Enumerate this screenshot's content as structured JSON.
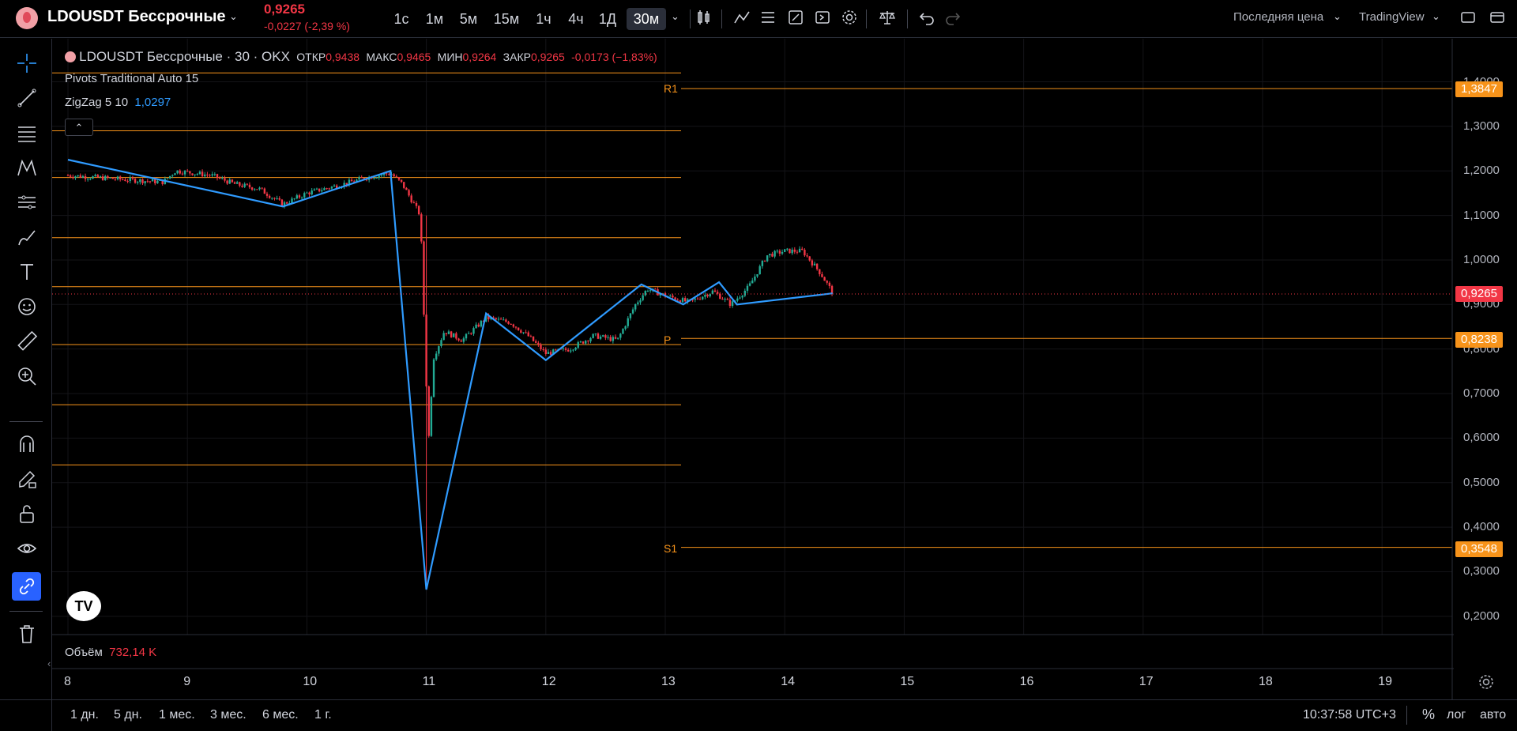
{
  "header": {
    "symbol": "LDOUSDT Бессрочные",
    "price": "0,9265",
    "change": "-0,0227 (-2,39 %)",
    "timeframes": [
      "1с",
      "1м",
      "5м",
      "15м",
      "1ч",
      "4ч",
      "1Д",
      "30м"
    ],
    "active_timeframe": "30м",
    "price_type": "Последняя цена",
    "brand": "TradingView"
  },
  "legend": {
    "title": "LDOUSDT Бессрочные · 30 · OKX",
    "open_label": "ОТКР",
    "open": "0,9438",
    "high_label": "МАКС",
    "high": "0,9465",
    "low_label": "МИН",
    "low": "0,9264",
    "close_label": "ЗАКР",
    "close": "0,9265",
    "delta": "-0,0173 (−1,83%)",
    "pivots": "Pivots Traditional Auto 15",
    "zigzag": "ZigZag 5 10",
    "zigzag_value": "1,0297",
    "volume_label": "Объём",
    "volume_value": "732,14 K"
  },
  "chart_data": {
    "type": "candlestick",
    "y_ticks": [
      "1,4000",
      "1,3000",
      "1,2000",
      "1,1000",
      "1,0000",
      "0,9000",
      "0,8000",
      "0,7000",
      "0,6000",
      "0,5000",
      "0,4000",
      "0,3000",
      "0,2000"
    ],
    "x_ticks": [
      "8",
      "9",
      "10",
      "11",
      "12",
      "13",
      "14",
      "15",
      "16",
      "17",
      "18",
      "19"
    ],
    "pivot_labels": {
      "r1": "R1",
      "p": "P",
      "s1": "S1"
    },
    "price_tags": {
      "r1": "1,3847",
      "last": "0,9265",
      "p": "0,8238",
      "s1": "0,3548"
    },
    "pivot_levels": [
      1.3847,
      0.8238,
      0.3548
    ],
    "zigzag_points": [
      [
        8.0,
        1.225
      ],
      [
        9.8,
        1.12
      ],
      [
        10.7,
        1.2
      ],
      [
        11.0,
        0.26
      ],
      [
        11.5,
        0.88
      ],
      [
        12.0,
        0.775
      ],
      [
        12.8,
        0.945
      ],
      [
        13.15,
        0.9
      ],
      [
        13.45,
        0.95
      ],
      [
        13.6,
        0.9
      ],
      [
        14.4,
        0.925
      ]
    ],
    "colors": {
      "up": "#22ab94",
      "down": "#f23645",
      "zigzag": "#2f9bff",
      "pivot": "#f7931a"
    }
  },
  "footer": {
    "ranges": [
      "1 дн.",
      "5 дн.",
      "1 мес.",
      "3 мес.",
      "6 мес.",
      "1 г."
    ],
    "time": "10:37:58 UTC+3",
    "percent": "%",
    "log": "лог",
    "auto": "авто"
  }
}
